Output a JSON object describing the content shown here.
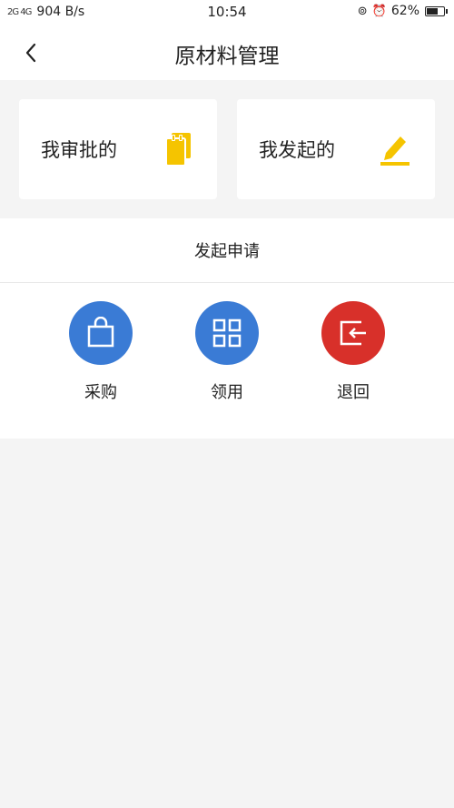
{
  "status": {
    "signal": "2G 4G",
    "speed": "904 B/s",
    "time": "10:54",
    "battery": "62%"
  },
  "header": {
    "title": "原材料管理"
  },
  "cards": {
    "approve_label": "我审批的",
    "initiated_label": "我发起的"
  },
  "apply": {
    "title": "发起申请",
    "actions": [
      {
        "label": "采购",
        "icon": "shopping-bag-icon",
        "color": "#3a7bd5"
      },
      {
        "label": "领用",
        "icon": "grid-icon",
        "color": "#3a7bd5"
      },
      {
        "label": "退回",
        "icon": "return-icon",
        "color": "#d8302a"
      }
    ]
  },
  "colors": {
    "accent_yellow": "#f5c400",
    "blue": "#3a7bd5",
    "red": "#d8302a"
  }
}
